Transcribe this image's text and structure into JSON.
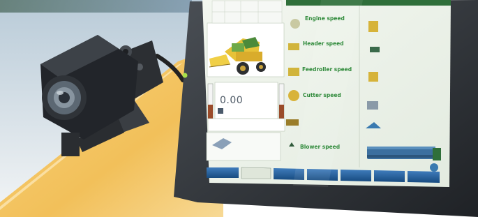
{
  "screen": {
    "status_right": "",
    "harvester_readout": {
      "value": "0.00",
      "unit": ""
    },
    "date_time": ""
  },
  "metrics_left": [
    {
      "label": "Engine speed",
      "value": "",
      "unit": ""
    },
    {
      "label": "Header speed",
      "value": "",
      "unit": ""
    },
    {
      "label": "Feedroller speed",
      "value": "",
      "unit": ""
    },
    {
      "label": "Cutter speed",
      "value": "",
      "unit": ""
    },
    {
      "label": "",
      "value": "",
      "unit": ""
    },
    {
      "label": "Blower speed",
      "value": "",
      "unit": ""
    }
  ],
  "metrics_right": [
    {
      "label": "",
      "value": "",
      "unit": ""
    },
    {
      "label": "",
      "value": "",
      "unit": ""
    },
    {
      "label": "",
      "value": "",
      "unit": ""
    },
    {
      "label": "",
      "value": "",
      "unit": ""
    },
    {
      "label": "",
      "value": "",
      "unit": ""
    }
  ],
  "tabs": [
    {
      "label": ""
    },
    {
      "label": ""
    },
    {
      "label": ""
    },
    {
      "label": ""
    },
    {
      "label": ""
    },
    {
      "label": ""
    },
    {
      "label": ""
    }
  ],
  "colors": {
    "bezel": "#2b2f33",
    "screen_bg": "#eef3ea",
    "tab_blue": "#1f5a96",
    "label_green": "#2f8a3a",
    "machine_yellow": "#e5b83a"
  }
}
